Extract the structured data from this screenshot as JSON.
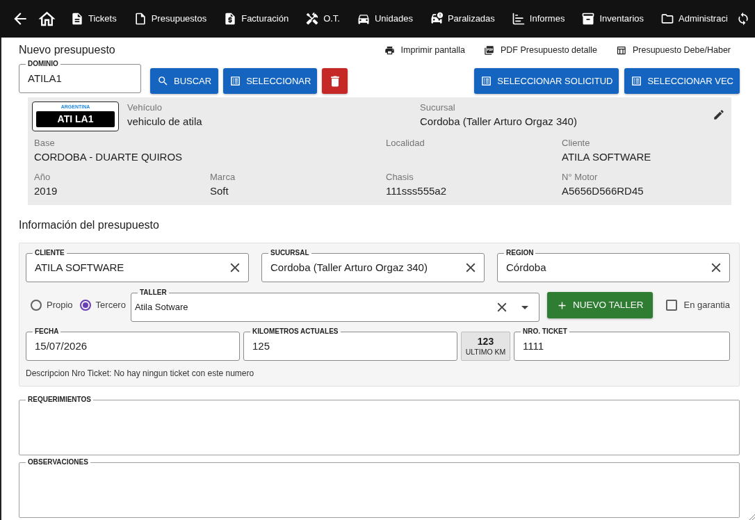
{
  "nav": {
    "items": [
      {
        "label": "Tickets"
      },
      {
        "label": "Presupuestos"
      },
      {
        "label": "Facturación"
      },
      {
        "label": "O.T."
      },
      {
        "label": "Unidades"
      },
      {
        "label": "Paralizadas"
      },
      {
        "label": "Informes"
      },
      {
        "label": "Inventarios"
      },
      {
        "label": "Administraci"
      }
    ]
  },
  "header": {
    "title": "Nuevo presupuesto",
    "actions": [
      {
        "label": "Imprimir pantalla"
      },
      {
        "label": "PDF Presupuesto detalle"
      },
      {
        "label": "Presupuesto Debe/Haber"
      }
    ]
  },
  "search": {
    "domain": {
      "label": "DOMINIO",
      "value": "ATILA1"
    },
    "buttons": [
      {
        "kind": "search",
        "label": "BUSCAR"
      },
      {
        "kind": "select",
        "label": "SELECCIONAR"
      },
      {
        "kind": "delete"
      }
    ],
    "select_buttons": [
      {
        "kind": "select",
        "label": "SELECCIONAR SOLICITUD"
      },
      {
        "kind": "select",
        "label": "SELECCIONAR VEC"
      }
    ]
  },
  "vehicle": {
    "plate": {
      "country": "ARGENTINA",
      "number": "ATI LA1"
    },
    "summary": [
      {
        "label": "Vehículo",
        "value": "vehiculo de atila"
      },
      {
        "label": "Sucursal",
        "value": "Cordoba (Taller Arturo Orgaz 340)"
      }
    ],
    "details": [
      [
        {
          "label": "Base",
          "value": "CORDOBA - DUARTE QUIROS"
        },
        {
          "label": "Localidad"
        },
        {
          "label": "Cliente",
          "value": "ATILA SOFTWARE"
        }
      ],
      [
        {
          "label": "Año",
          "value": "2019"
        },
        {
          "label": "Marca",
          "value": "Soft"
        },
        {
          "label": "Chasis",
          "value": "111sss555a2"
        },
        {
          "label": "N° Motor",
          "value": "A5656D566RD45"
        }
      ]
    ]
  },
  "info": {
    "title": "Información del presupuesto",
    "location_fields": [
      {
        "label": "CLIENTE",
        "value": "ATILA SOFTWARE"
      },
      {
        "label": "SUCURSAL",
        "value": "Cordoba (Taller Arturo Orgaz 340)"
      },
      {
        "label": "REGION",
        "value": "Córdoba"
      }
    ],
    "workshop_type": [
      {
        "label": "Propio",
        "selected": false
      },
      {
        "label": "Tercero",
        "selected": true
      }
    ],
    "workshop": {
      "label": "TALLER",
      "value": "Atila Sotware"
    },
    "new_workshop_button": {
      "label": "NUEVO TALLER"
    },
    "warranty": {
      "label": "En garantia",
      "checked": false
    },
    "date": {
      "label": "FECHA",
      "value": "15/07/2026"
    },
    "mileage": {
      "label": "KILOMETROS ACTUALES",
      "value": "125"
    },
    "last_mileage": {
      "value": "123",
      "label": "ULTIMO KM"
    },
    "ticket": {
      "label": "NRO. TICKET",
      "value": "1111"
    },
    "ticket_description": "Descripcion Nro Ticket: No hay ningun ticket con este numero"
  },
  "notes": [
    {
      "label": "REQUERIMIENTOS"
    },
    {
      "label": "OBSERVACIONES"
    }
  ]
}
